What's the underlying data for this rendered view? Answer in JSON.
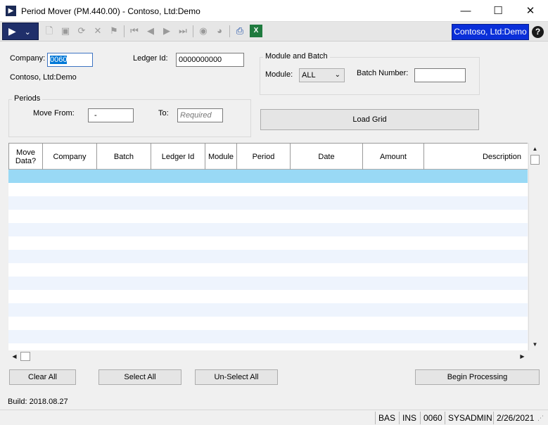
{
  "window": {
    "title": "Period Mover (PM.440.00) - Contoso, Ltd:Demo",
    "minimize_icon": "minimize-icon",
    "maximize_icon": "maximize-icon",
    "close_icon": "close-icon"
  },
  "toolbar": {
    "company_badge": "Contoso, Ltd:Demo",
    "help_label": "?"
  },
  "form": {
    "company_label": "Company:",
    "company_value": "0060",
    "company_name": "Contoso, Ltd:Demo",
    "ledger_label": "Ledger Id:",
    "ledger_value": "0000000000",
    "module_batch_group": "Module and Batch",
    "module_label": "Module:",
    "module_value": "ALL",
    "batch_label": "Batch Number:",
    "batch_value": "",
    "periods_group": "Periods",
    "move_from_label": "Move From:",
    "move_from_value": "-",
    "to_label": "To:",
    "to_placeholder": "Required",
    "load_grid": "Load Grid"
  },
  "grid": {
    "columns": [
      "Move Data?",
      "Company",
      "Batch",
      "Ledger Id",
      "Module",
      "Period",
      "Date",
      "Amount",
      "Description"
    ],
    "rows": []
  },
  "buttons": {
    "clear_all": "Clear All",
    "select_all": "Select All",
    "unselect_all": "Un-Select All",
    "begin_processing": "Begin Processing"
  },
  "build": "Build: 2018.08.27",
  "status": {
    "mode1": "BAS",
    "mode2": "INS",
    "company": "0060",
    "user": "SYSADMIN",
    "date": "2/26/2021"
  },
  "colors": {
    "accent": "#0a2fd9",
    "selected_row": "#99d9f5",
    "alt_row": "#eef4fd"
  }
}
